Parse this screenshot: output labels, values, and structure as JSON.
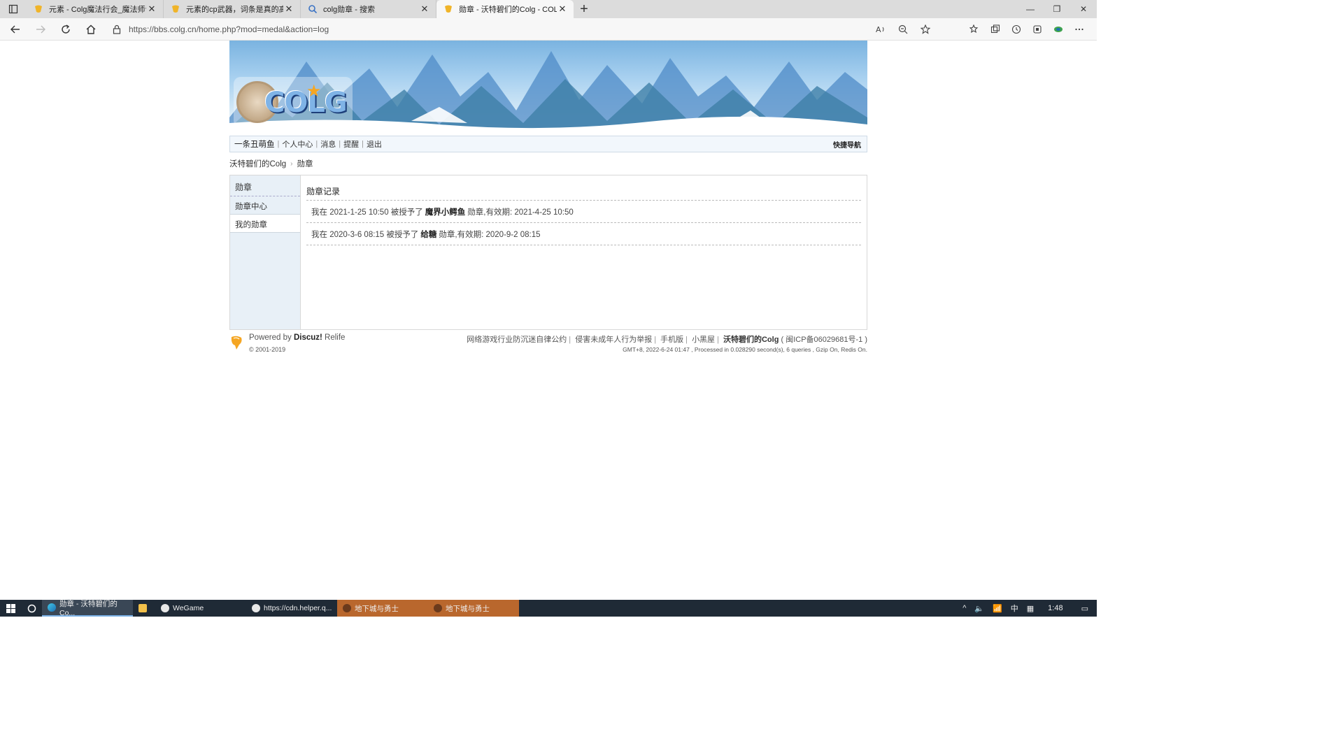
{
  "browser": {
    "tabs": [
      {
        "title": "元素 - Colg魔法行会_魔法师讨论",
        "active": false
      },
      {
        "title": "元素的cp武器，词条是真的高啊",
        "active": false
      },
      {
        "title": "colg勋章 - 搜索",
        "active": false
      },
      {
        "title": "勋章 - 沃特碧们的Colg - COLG社",
        "active": true
      }
    ],
    "new_tab": "+",
    "url": "https://bbs.colg.cn/home.php?mod=medal&action=log",
    "window_controls": {
      "minimize": "—",
      "restore": "❐",
      "close": "✕"
    }
  },
  "site": {
    "logo_text": "COLG"
  },
  "navbar": {
    "username": "一条丑萌鱼",
    "items": [
      "个人中心",
      "消息",
      "提醒",
      "退出"
    ],
    "quicknav": "快捷导航"
  },
  "breadcrumb": {
    "home": "沃特碧们的Colg",
    "current": "勋章"
  },
  "sidebar": {
    "header": "勋章",
    "items": [
      {
        "label": "勋章中心",
        "active": false
      },
      {
        "label": "我的勋章",
        "active": true
      }
    ]
  },
  "main": {
    "title": "勋章记录",
    "records": [
      {
        "prefix": "我在 2021-1-25 10:50 被授予了",
        "medal": "魔界小鳄鱼",
        "suffix": "勋章,有效期: 2021-4-25 10:50"
      },
      {
        "prefix": "我在 2020-3-6 08:15 被授予了",
        "medal": "给糖",
        "suffix": "勋章,有效期: 2020-9-2 08:15"
      }
    ]
  },
  "footer": {
    "powered_prefix": "Powered by",
    "powered_brand": "Discuz!",
    "powered_suffix": "Relife",
    "copyright": "© 2001-2019",
    "links": [
      "网络游戏行业防沉迷自律公约",
      "侵害未成年人行为举报",
      "手机版",
      "小黑屋"
    ],
    "site_name": "沃特碧们的Colg",
    "icp": "( 闽ICP备06029681号-1 )",
    "processed": "GMT+8, 2022-6-24 01:47 , Processed in 0.028290 second(s), 6 queries , Gzip On, Redis On."
  },
  "taskbar": {
    "apps": [
      {
        "label": "勋章 - 沃特碧们的Co...",
        "state": "active"
      },
      {
        "label": "",
        "state": "normal"
      },
      {
        "label": "WeGame",
        "state": "normal"
      },
      {
        "label": "https://cdn.helper.q...",
        "state": "normal"
      },
      {
        "label": "地下城与勇士",
        "state": "orange"
      },
      {
        "label": "地下城与勇士",
        "state": "orange"
      }
    ],
    "ime": "中",
    "time": "1:48"
  },
  "colors": {
    "nav_bg": "#f2f7fc",
    "sidebar_bg": "#e8f0f7",
    "taskbar_bg": "#1f2a36",
    "taskbar_orange": "#b9672d"
  }
}
